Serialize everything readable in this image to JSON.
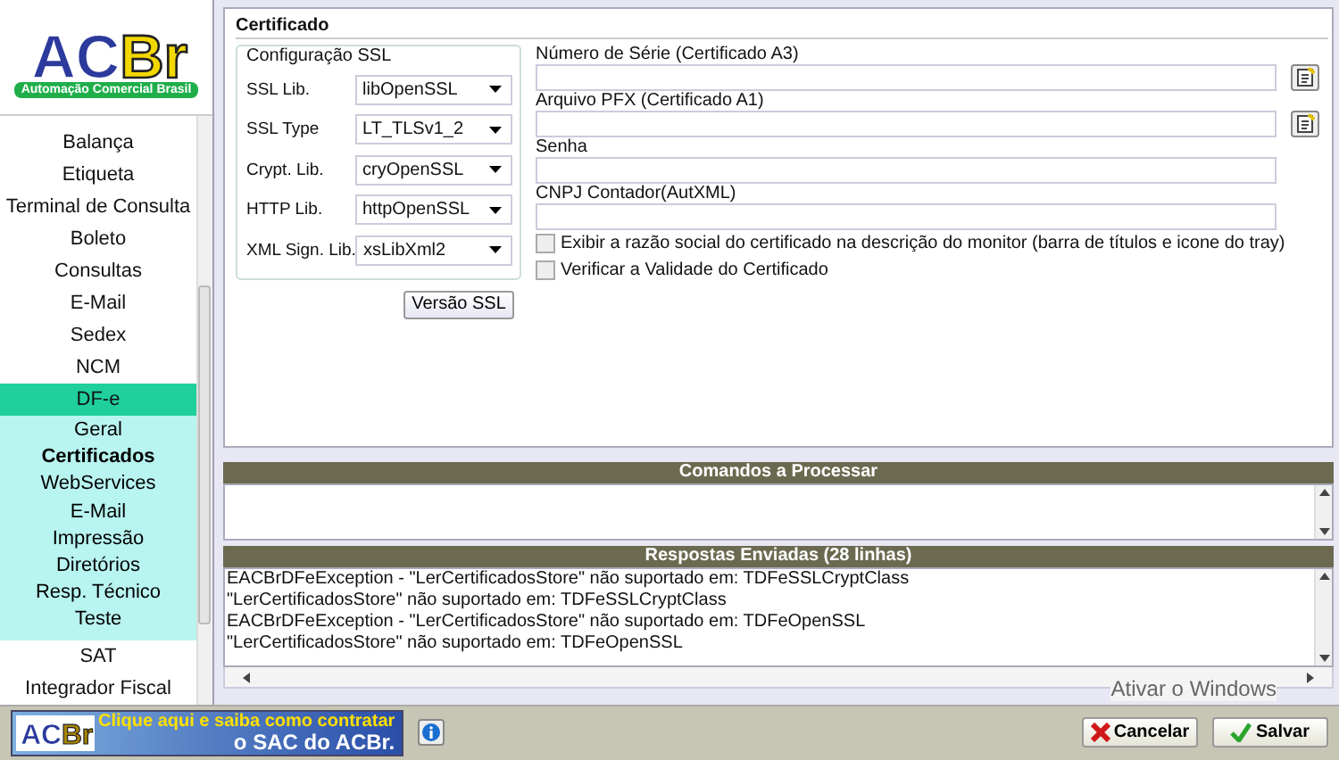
{
  "logo": {
    "text": "ACBr",
    "tagline": "Automação Comercial Brasil"
  },
  "sidebar": {
    "items": [
      {
        "label": "Balança",
        "selected": false
      },
      {
        "label": "Etiqueta",
        "selected": false
      },
      {
        "label": "Terminal de Consulta",
        "selected": false
      },
      {
        "label": "Boleto",
        "selected": false
      },
      {
        "label": "Consultas",
        "selected": false
      },
      {
        "label": "E-Mail",
        "selected": false
      },
      {
        "label": "Sedex",
        "selected": false
      },
      {
        "label": "NCM",
        "selected": false
      },
      {
        "label": "DF-e",
        "selected": false,
        "expanded": true,
        "children": [
          {
            "label": "Geral",
            "selected": false
          },
          {
            "label": "Certificados",
            "selected": true
          },
          {
            "label": "WebServices",
            "selected": false
          },
          {
            "label": "E-Mail",
            "selected": false
          },
          {
            "label": "Impressão",
            "selected": false
          },
          {
            "label": "Diretórios",
            "selected": false
          },
          {
            "label": "Resp. Técnico",
            "selected": false
          },
          {
            "label": "Teste",
            "selected": false
          }
        ]
      },
      {
        "label": "SAT",
        "selected": false
      },
      {
        "label": "Integrador Fiscal",
        "selected": false
      }
    ]
  },
  "certificate": {
    "title": "Certificado",
    "ssl_config": {
      "title": "Configuração SSL",
      "rows": [
        {
          "label": "SSL Lib.",
          "value": "libOpenSSL"
        },
        {
          "label": "SSL Type",
          "value": "LT_TLSv1_2"
        },
        {
          "label": "Crypt. Lib.",
          "value": "cryOpenSSL"
        },
        {
          "label": "HTTP Lib.",
          "value": "httpOpenSSL"
        },
        {
          "label": "XML Sign. Lib.",
          "value": "xsLibXml2"
        }
      ],
      "button": "Versão SSL"
    },
    "fields": [
      {
        "label": "Número de Série (Certificado A3)",
        "browse": true
      },
      {
        "label": "Arquivo PFX (Certificado A1)",
        "browse": true
      },
      {
        "label": "Senha",
        "browse": false
      },
      {
        "label": "CNPJ Contador(AutXML)",
        "browse": false
      }
    ],
    "checkboxes": [
      {
        "label": "Exibir a razão social do certificado na descrição do monitor (barra de títulos e icone do tray)",
        "checked": false
      },
      {
        "label": "Verificar a Validade do Certificado",
        "checked": false
      }
    ]
  },
  "commands": {
    "title": "Comandos a Processar"
  },
  "responses": {
    "title": "Respostas Enviadas (28 linhas)",
    "lines": [
      "EACBrDFeException - \"LerCertificadosStore\" não suportado em: TDFeSSLCryptClass",
      "\"LerCertificadosStore\" não suportado em: TDFeSSLCryptClass",
      "EACBrDFeException - \"LerCertificadosStore\" não suportado em: TDFeOpenSSL",
      "\"LerCertificadosStore\" não suportado em: TDFeOpenSSL"
    ]
  },
  "footer": {
    "banner": {
      "logo": "ACBr",
      "line1": "Clique aqui e saiba como contratar",
      "line2": "o SAC do ACBr."
    },
    "buttons": [
      {
        "label": "Cancelar",
        "kind": "cancel"
      },
      {
        "label": "Salvar",
        "kind": "save"
      }
    ]
  },
  "watermark": "Ativar o Windows"
}
